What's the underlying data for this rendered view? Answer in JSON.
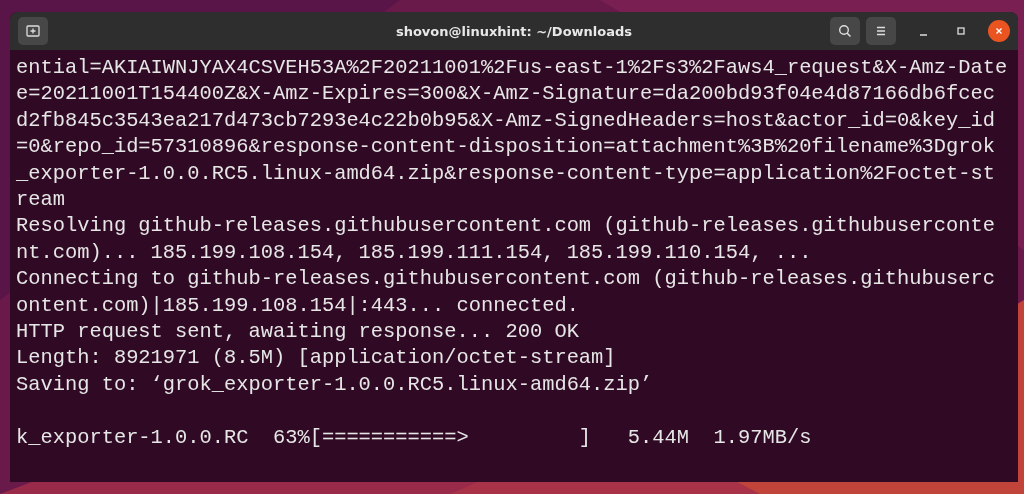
{
  "window": {
    "title": "shovon@linuxhint: ~/Downloads"
  },
  "terminal": {
    "lines": [
      {
        "text": "ential=AKIAIWNJYAX4CSVEH53A%2F20211001%2Fus-east-1%2Fs3%2Faws4_request&X-Amz-Date"
      },
      {
        "text": "e=20211001T154400Z&X-Amz-Expires=300&X-Amz-Signature=da200bd93f04e4d87166db6fcec"
      },
      {
        "text": "d2fb845c3543ea217d473cb7293e4c22b0b95&X-Amz-SignedHeaders=host&actor_id=0&key_id"
      },
      {
        "text": "=0&repo_id=57310896&response-content-disposition=attachment%3B%20filename%3Dgrok"
      },
      {
        "text": "_exporter-1.0.0.RC5.linux-amd64.zip&response-content-type=application%2Foctet-st"
      },
      {
        "text": "ream"
      },
      {
        "text": "Resolving github-releases.githubusercontent.com (github-releases.githubuserconte"
      },
      {
        "text": "nt.com)... 185.199.108.154, 185.199.111.154, 185.199.110.154, ..."
      },
      {
        "text": "Connecting to github-releases.githubusercontent.com (github-releases.githubuserc"
      },
      {
        "text": "ontent.com)|185.199.108.154|:443... connected."
      },
      {
        "text": "HTTP request sent, awaiting response... 200 OK"
      },
      {
        "text": "Length: 8921971 (8.5M) [application/octet-stream]"
      },
      {
        "text": "Saving to: ‘grok_exporter-1.0.0.RC5.linux-amd64.zip’"
      }
    ],
    "progress": "k_exporter-1.0.0.RC  63%[===========>         ]   5.44M  1.97MB/s"
  }
}
